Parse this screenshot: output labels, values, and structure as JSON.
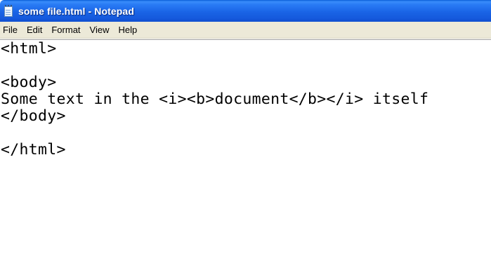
{
  "window": {
    "title": "some file.html - Notepad",
    "icon": "notepad-icon"
  },
  "menubar": {
    "items": [
      "File",
      "Edit",
      "Format",
      "View",
      "Help"
    ]
  },
  "editor": {
    "lines": [
      "<html>",
      "",
      "<body>",
      "Some text in the <i><b>document</b></i> itself",
      "</body>",
      "",
      "</html>"
    ]
  },
  "colors": {
    "titlebar": "#1a64e6",
    "menubar": "#ece9d8",
    "editor_background": "#ffffff",
    "text": "#000000"
  }
}
